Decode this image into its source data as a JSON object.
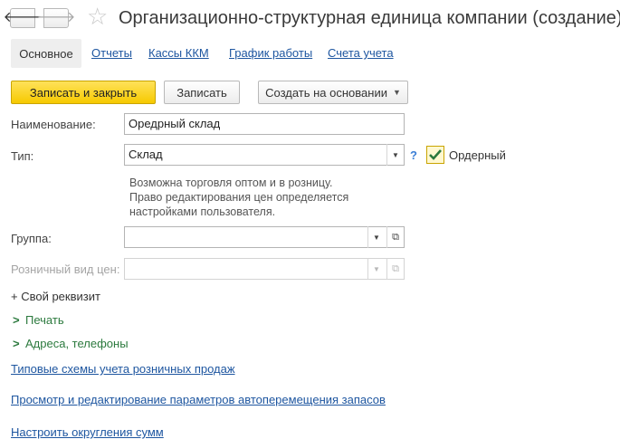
{
  "header": {
    "title": "Организационно-структурная единица компании (создание) *",
    "back_glyph": "🡐",
    "forward_glyph": "🡒",
    "star_glyph": "☆"
  },
  "tabs": [
    {
      "label": "Основное",
      "active": true
    },
    {
      "label": "Отчеты"
    },
    {
      "label": "Кассы ККМ"
    },
    {
      "label": "График работы"
    },
    {
      "label": "Счета учета"
    }
  ],
  "toolbar": {
    "save_close_label": "Записать и закрыть",
    "save_label": "Записать",
    "create_based_label": "Создать на основании"
  },
  "form": {
    "name_label": "Наименование:",
    "name_value": "Оредрный склад",
    "type_label": "Тип:",
    "type_value": "Склад",
    "help_mark": "?",
    "ordered_label": "Ордерный",
    "ordered_checked": true,
    "hint_lines": [
      "Возможна торговля оптом и в розницу.",
      "Право редактирования цен определяется",
      "настройками пользователя."
    ],
    "group_label": "Группа:",
    "group_value": "",
    "price_type_label": "Розничный вид цен:",
    "price_type_value": ""
  },
  "sections": {
    "custom_attr": "+ Свой реквизит",
    "print": "Печать",
    "addresses": "Адреса, телефоны"
  },
  "links": {
    "retail_schemes": "Типовые схемы учета розничных продаж",
    "auto_transfer": "Просмотр и редактирование параметров автоперемещения запасов",
    "rounding": "Настроить округления сумм"
  },
  "colors": {
    "accent_yellow": "#f6c900",
    "link_blue": "#1e56a0",
    "section_green": "#2c7a3e",
    "help_blue": "#3b7fd6"
  }
}
